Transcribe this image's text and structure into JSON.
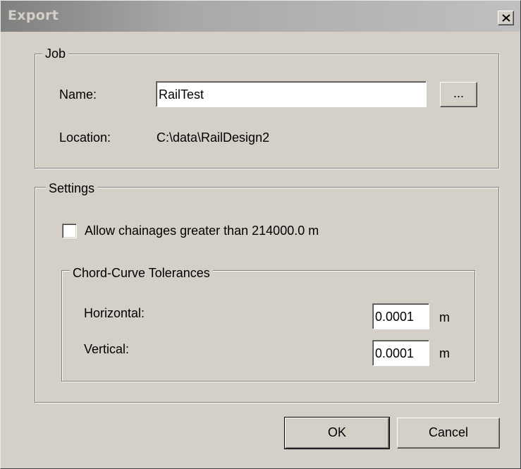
{
  "window": {
    "title": "Export",
    "close_icon": "close-icon"
  },
  "job": {
    "legend": "Job",
    "name_label": "Name:",
    "name_value": "RailTest",
    "browse_label": "...",
    "location_label": "Location:",
    "location_value": "C:\\data\\RailDesign2"
  },
  "settings": {
    "legend": "Settings",
    "allow_chainages_label": "Allow chainages greater than 214000.0 m",
    "allow_chainages_checked": false,
    "tolerances": {
      "legend": "Chord-Curve Tolerances",
      "horizontal_label": "Horizontal:",
      "horizontal_value": "0.0001",
      "horizontal_unit": "m",
      "vertical_label": "Vertical:",
      "vertical_value": "0.0001",
      "vertical_unit": "m"
    }
  },
  "buttons": {
    "ok": "OK",
    "cancel": "Cancel"
  },
  "colors": {
    "face": "#d4d0c8",
    "title_gradient_start": "#808080",
    "title_gradient_end": "#c0c0c0"
  }
}
